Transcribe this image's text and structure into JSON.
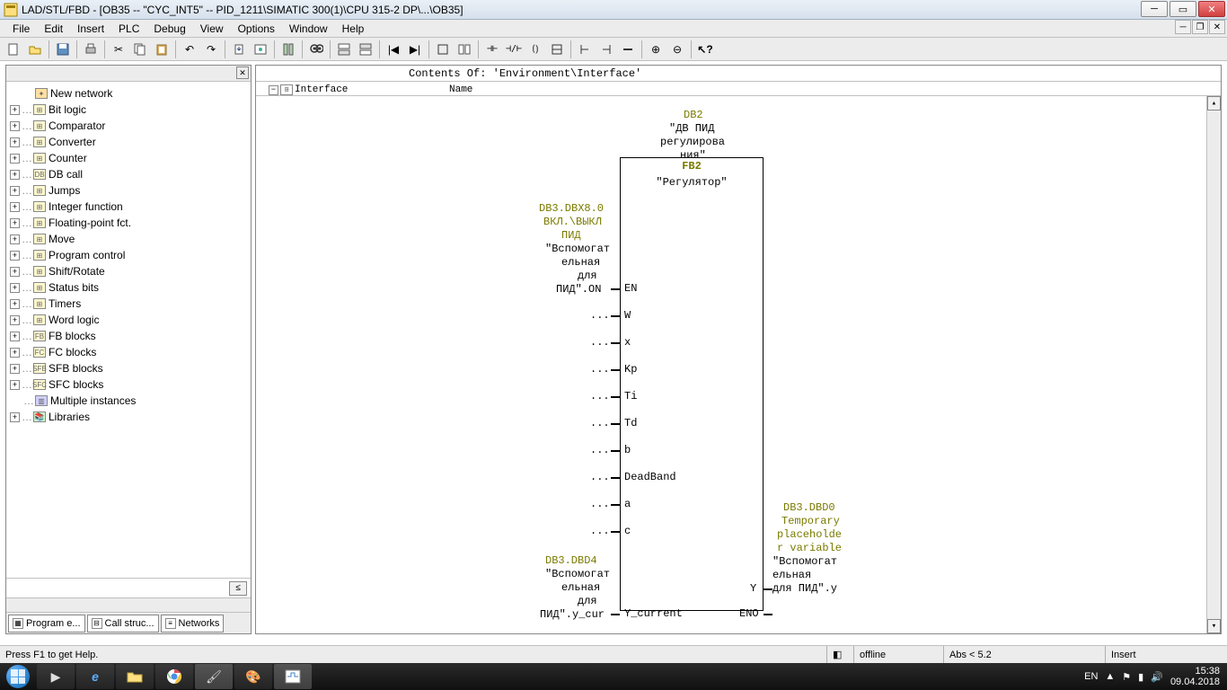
{
  "window": {
    "title": "LAD/STL/FBD  - [OB35 -- \"CYC_INT5\" -- PID_1211\\SIMATIC 300(1)\\CPU 315-2 DP\\...\\OB35]"
  },
  "menu": [
    "File",
    "Edit",
    "Insert",
    "PLC",
    "Debug",
    "View",
    "Options",
    "Window",
    "Help"
  ],
  "tree": {
    "items": [
      {
        "label": "New network",
        "expandable": false,
        "special": true
      },
      {
        "label": "Bit logic",
        "expandable": true
      },
      {
        "label": "Comparator",
        "expandable": true
      },
      {
        "label": "Converter",
        "expandable": true
      },
      {
        "label": "Counter",
        "expandable": true
      },
      {
        "label": "DB call",
        "expandable": true,
        "iconText": "DB"
      },
      {
        "label": "Jumps",
        "expandable": true
      },
      {
        "label": "Integer function",
        "expandable": true
      },
      {
        "label": "Floating-point fct.",
        "expandable": true
      },
      {
        "label": "Move",
        "expandable": true
      },
      {
        "label": "Program control",
        "expandable": true
      },
      {
        "label": "Shift/Rotate",
        "expandable": true
      },
      {
        "label": "Status bits",
        "expandable": true
      },
      {
        "label": "Timers",
        "expandable": true
      },
      {
        "label": "Word logic",
        "expandable": true
      },
      {
        "label": "FB blocks",
        "expandable": true,
        "iconText": "FB"
      },
      {
        "label": "FC blocks",
        "expandable": true,
        "iconText": "FC"
      },
      {
        "label": "SFB blocks",
        "expandable": true,
        "iconText": "SFB"
      },
      {
        "label": "SFC blocks",
        "expandable": true,
        "iconText": "SFC"
      },
      {
        "label": "Multiple instances",
        "expandable": false
      },
      {
        "label": "Libraries",
        "expandable": true
      }
    ]
  },
  "bottomTabs": [
    {
      "label": "Program e..."
    },
    {
      "label": "Call struc..."
    },
    {
      "label": "Networks"
    }
  ],
  "contents": {
    "header": "Contents Of: 'Environment\\Interface'",
    "interfaceLabel": "Interface",
    "nameCol": "Name"
  },
  "fb": {
    "db": "DB2",
    "dbComment1": "\"ДВ ПИД",
    "dbComment2": "регулирова",
    "dbComment3": "ния\"",
    "fbNum": "FB2",
    "fbName": "\"Регулятор\"",
    "inputs": {
      "en_addr": "DB3.DBX8.0",
      "en_sym1": "ВКЛ.\\ВЫКЛ",
      "en_sym2": "ПИД",
      "en_txt1": "\"Вспомогат",
      "en_txt2": "ельная",
      "en_txt3": "для",
      "en_txt4": "ПИД\".ON",
      "pins": [
        "EN",
        "W",
        "x",
        "Kp",
        "Ti",
        "Td",
        "b",
        "DeadBand",
        "a",
        "c",
        "Y_current"
      ],
      "ellipsis": "...",
      "ycur_addr": "DB3.DBD4",
      "ycur_txt1": "\"Вспомогат",
      "ycur_txt2": "ельная",
      "ycur_txt3": "для",
      "ycur_txt4": "ПИД\".y_cur"
    },
    "outputs": {
      "y": "Y",
      "eno": "ENO",
      "y_addr": "DB3.DBD0",
      "y_sym1": "Temporary",
      "y_sym2": "placeholde",
      "y_sym3": "r variable",
      "y_txt1": "\"Вспомогат",
      "y_txt2": "ельная",
      "y_txt3": "для ПИД\".y"
    }
  },
  "status": {
    "help": "Press F1 to get Help.",
    "offline": "offline",
    "abs": "Abs < 5.2",
    "insert": "Insert"
  },
  "tray": {
    "lang": "EN",
    "time": "15:38",
    "date": "09.04.2018"
  }
}
